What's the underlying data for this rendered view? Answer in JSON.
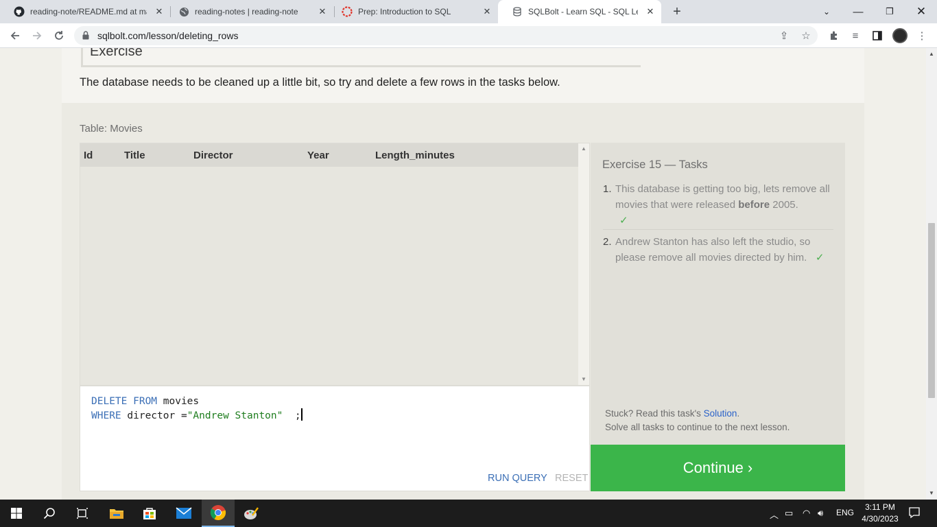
{
  "browser": {
    "tabs": [
      {
        "title": "reading-note/README.md at ma",
        "icon": "github-icon"
      },
      {
        "title": "reading-notes | reading-note",
        "icon": "globe-icon"
      },
      {
        "title": "Prep: Introduction to SQL",
        "icon": "canvas-icon"
      },
      {
        "title": "SQLBolt - Learn SQL - SQL Lesson",
        "icon": "database-icon"
      }
    ],
    "active_tab": 3,
    "url": "sqlbolt.com/lesson/deleting_rows"
  },
  "page": {
    "exercise_heading": "Exercise",
    "intro": "The database needs to be cleaned up a little bit, so try and delete a few rows in the tasks below.",
    "table_caption": "Table: Movies",
    "columns": [
      "Id",
      "Title",
      "Director",
      "Year",
      "Length_minutes"
    ],
    "query": {
      "kw1": "DELETE FROM",
      "table": " movies",
      "kw2": "WHERE",
      "cond": " director =",
      "value": "\"Andrew Stanton\"",
      "end": "  ;"
    },
    "run_label": "RUN QUERY",
    "reset_label": "RESET",
    "tasks_title": "Exercise 15 — Tasks",
    "tasks": [
      {
        "num": "1.",
        "pre": "This database is getting too big, lets remove all movies that were released ",
        "bold": "before",
        "post": " 2005.",
        "check": "✓"
      },
      {
        "num": "2.",
        "pre": "Andrew Stanton has also left the studio, so please remove all movies directed by him.",
        "bold": "",
        "post": "",
        "check": "✓"
      }
    ],
    "stuck_pre": "Stuck? Read this task's ",
    "solution_link": "Solution",
    "stuck_post": ".",
    "solve_all": "Solve all tasks to continue to the next lesson.",
    "continue_label": "Continue ›"
  },
  "taskbar": {
    "language": "ENG",
    "time": "3:11 PM",
    "date": "4/30/2023"
  },
  "colors": {
    "continue": "#3bb54a",
    "keyword": "#3b6fb6",
    "string": "#1e7d1e",
    "link": "#2a62c9"
  }
}
